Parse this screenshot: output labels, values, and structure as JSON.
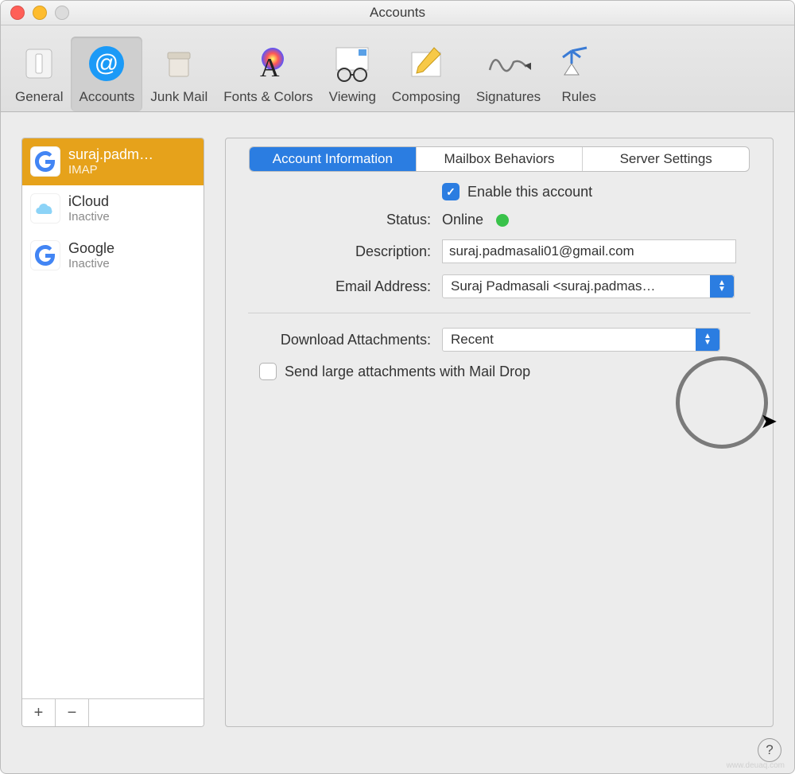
{
  "window": {
    "title": "Accounts"
  },
  "toolbar": {
    "items": [
      {
        "label": "General"
      },
      {
        "label": "Accounts"
      },
      {
        "label": "Junk Mail"
      },
      {
        "label": "Fonts & Colors"
      },
      {
        "label": "Viewing"
      },
      {
        "label": "Composing"
      },
      {
        "label": "Signatures"
      },
      {
        "label": "Rules"
      }
    ],
    "selected_index": 1
  },
  "sidebar": {
    "accounts": [
      {
        "name": "suraj.padm…",
        "sub": "IMAP",
        "provider": "google",
        "selected": true
      },
      {
        "name": "iCloud",
        "sub": "Inactive",
        "provider": "icloud",
        "selected": false
      },
      {
        "name": "Google",
        "sub": "Inactive",
        "provider": "google",
        "selected": false
      }
    ],
    "add_symbol": "+",
    "remove_symbol": "−"
  },
  "tabs": {
    "items": [
      "Account Information",
      "Mailbox Behaviors",
      "Server Settings"
    ],
    "active_index": 0
  },
  "form": {
    "enable_label": "Enable this account",
    "enable_checked": true,
    "status_label": "Status:",
    "status_value": "Online",
    "status_color": "#39c24a",
    "description_label": "Description:",
    "description_value": "suraj.padmasali01@gmail.com",
    "email_label": "Email Address:",
    "email_value": "Suraj Padmasali <suraj.padmas…",
    "download_label": "Download Attachments:",
    "download_value": "Recent",
    "maildrop_label": "Send large attachments with Mail Drop",
    "maildrop_checked": false
  },
  "help_symbol": "?",
  "watermark": "www.deuaq.com"
}
